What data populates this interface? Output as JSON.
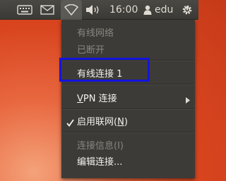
{
  "topbar": {
    "clock": "16:00",
    "user": "edu",
    "icons": [
      "keyboard-icon",
      "mail-icon",
      "network-wireless-icon",
      "volume-icon",
      "user-icon",
      "power-gear-icon"
    ]
  },
  "menu": {
    "wired_header": "有线网络",
    "wired_status": "已断开",
    "connection_item": "有线连接 1",
    "vpn_item_before": "",
    "vpn_item_underlined": "V",
    "vpn_item_after": "PN 连接",
    "enable_network_before": "启用联网(",
    "enable_network_underlined": "N",
    "enable_network_after": ")",
    "connection_info": "连接信息(I)",
    "edit_connections": "编辑连接..."
  },
  "colors": {
    "highlight": "#1414dc",
    "menu_bg": "#3c3b37",
    "panel_bg": "#3b3a36"
  }
}
